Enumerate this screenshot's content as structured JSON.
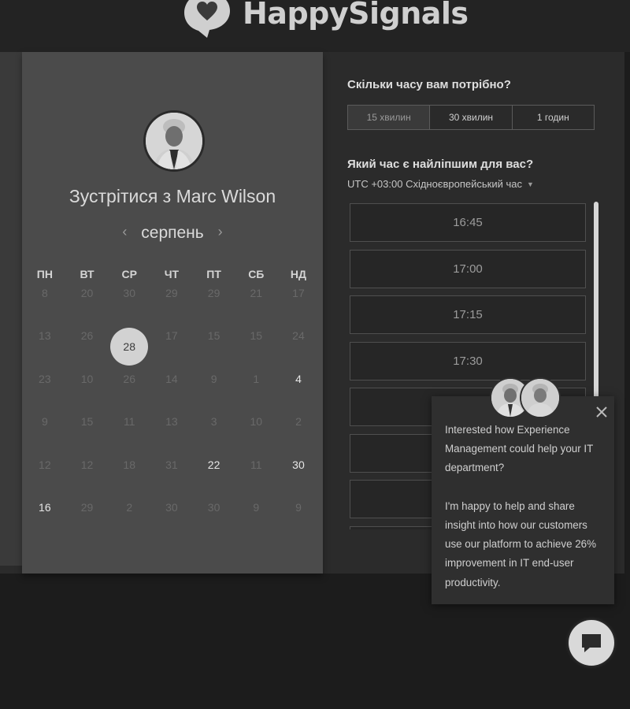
{
  "header": {
    "brand": "HappySignals"
  },
  "host": {
    "meet_prefix": "Зустрітися з",
    "name": "Marc Wilson"
  },
  "calendar": {
    "month": "серпень",
    "weekdays": [
      "ПН",
      "ВТ",
      "СР",
      "ЧТ",
      "ПТ",
      "СБ",
      "НД"
    ],
    "selected_day": "28",
    "rows": [
      [
        {
          "d": "8"
        },
        {
          "d": "20"
        },
        {
          "d": "30"
        },
        {
          "d": "29"
        },
        {
          "d": "29"
        },
        {
          "d": "21"
        },
        {
          "d": "17"
        }
      ],
      [
        {
          "d": "13"
        },
        {
          "d": "26"
        },
        {
          "d": "28",
          "selected": true
        },
        {
          "d": "17"
        },
        {
          "d": "15"
        },
        {
          "d": "15"
        },
        {
          "d": "24"
        }
      ],
      [
        {
          "d": "23"
        },
        {
          "d": "10"
        },
        {
          "d": "26"
        },
        {
          "d": "14"
        },
        {
          "d": "9"
        },
        {
          "d": "1"
        },
        {
          "d": "4",
          "active": true
        }
      ],
      [
        {
          "d": "9"
        },
        {
          "d": "15"
        },
        {
          "d": "11"
        },
        {
          "d": "13"
        },
        {
          "d": "3"
        },
        {
          "d": "10"
        },
        {
          "d": "2"
        }
      ],
      [
        {
          "d": "12"
        },
        {
          "d": "12"
        },
        {
          "d": "18"
        },
        {
          "d": "31"
        },
        {
          "d": "22",
          "active": true
        },
        {
          "d": "11"
        },
        {
          "d": "30",
          "active": true
        }
      ],
      [
        {
          "d": "16",
          "active": true
        },
        {
          "d": "29"
        },
        {
          "d": "2"
        },
        {
          "d": "30"
        },
        {
          "d": "30"
        },
        {
          "d": "9"
        },
        {
          "d": "9"
        }
      ]
    ]
  },
  "duration": {
    "question": "Скільки часу вам потрібно?",
    "options": [
      "15 хвилин",
      "30 хвилин",
      "1 годин"
    ],
    "selected_index": 0
  },
  "times": {
    "question": "Який час є найліпшим для вас?",
    "timezone": "UTC +03:00 Східноєвропейський час",
    "slots": [
      "16:45",
      "17:00",
      "17:15",
      "17:30",
      "",
      "",
      "",
      ""
    ]
  },
  "chat": {
    "message": "Interested how Experience Management could help your IT department?\n\nI'm happy to help and share insight into how our customers use our platform to achieve 26% improvement in IT end-user productivity."
  }
}
